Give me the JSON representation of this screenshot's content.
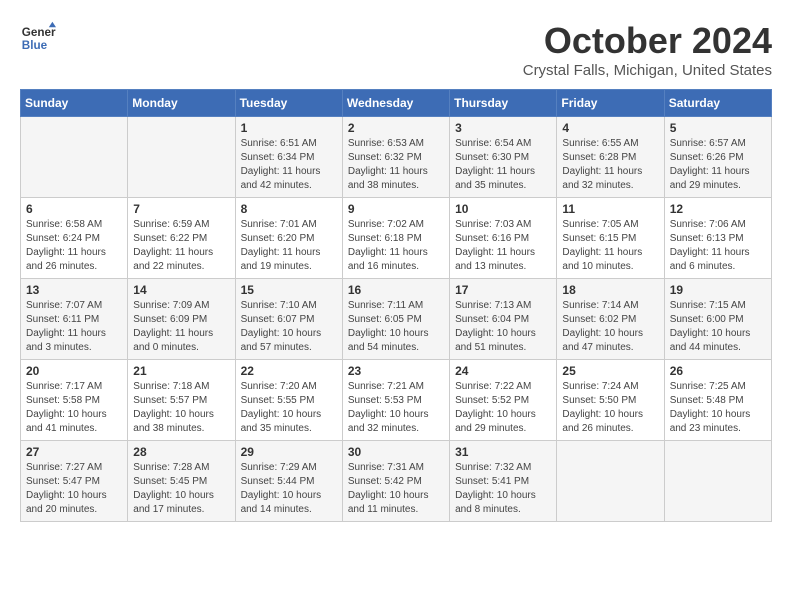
{
  "logo": {
    "line1": "General",
    "line2": "Blue"
  },
  "title": "October 2024",
  "location": "Crystal Falls, Michigan, United States",
  "days_of_week": [
    "Sunday",
    "Monday",
    "Tuesday",
    "Wednesday",
    "Thursday",
    "Friday",
    "Saturday"
  ],
  "weeks": [
    [
      {
        "day": "",
        "info": ""
      },
      {
        "day": "",
        "info": ""
      },
      {
        "day": "1",
        "sunrise": "Sunrise: 6:51 AM",
        "sunset": "Sunset: 6:34 PM",
        "daylight": "Daylight: 11 hours and 42 minutes."
      },
      {
        "day": "2",
        "sunrise": "Sunrise: 6:53 AM",
        "sunset": "Sunset: 6:32 PM",
        "daylight": "Daylight: 11 hours and 38 minutes."
      },
      {
        "day": "3",
        "sunrise": "Sunrise: 6:54 AM",
        "sunset": "Sunset: 6:30 PM",
        "daylight": "Daylight: 11 hours and 35 minutes."
      },
      {
        "day": "4",
        "sunrise": "Sunrise: 6:55 AM",
        "sunset": "Sunset: 6:28 PM",
        "daylight": "Daylight: 11 hours and 32 minutes."
      },
      {
        "day": "5",
        "sunrise": "Sunrise: 6:57 AM",
        "sunset": "Sunset: 6:26 PM",
        "daylight": "Daylight: 11 hours and 29 minutes."
      }
    ],
    [
      {
        "day": "6",
        "sunrise": "Sunrise: 6:58 AM",
        "sunset": "Sunset: 6:24 PM",
        "daylight": "Daylight: 11 hours and 26 minutes."
      },
      {
        "day": "7",
        "sunrise": "Sunrise: 6:59 AM",
        "sunset": "Sunset: 6:22 PM",
        "daylight": "Daylight: 11 hours and 22 minutes."
      },
      {
        "day": "8",
        "sunrise": "Sunrise: 7:01 AM",
        "sunset": "Sunset: 6:20 PM",
        "daylight": "Daylight: 11 hours and 19 minutes."
      },
      {
        "day": "9",
        "sunrise": "Sunrise: 7:02 AM",
        "sunset": "Sunset: 6:18 PM",
        "daylight": "Daylight: 11 hours and 16 minutes."
      },
      {
        "day": "10",
        "sunrise": "Sunrise: 7:03 AM",
        "sunset": "Sunset: 6:16 PM",
        "daylight": "Daylight: 11 hours and 13 minutes."
      },
      {
        "day": "11",
        "sunrise": "Sunrise: 7:05 AM",
        "sunset": "Sunset: 6:15 PM",
        "daylight": "Daylight: 11 hours and 10 minutes."
      },
      {
        "day": "12",
        "sunrise": "Sunrise: 7:06 AM",
        "sunset": "Sunset: 6:13 PM",
        "daylight": "Daylight: 11 hours and 6 minutes."
      }
    ],
    [
      {
        "day": "13",
        "sunrise": "Sunrise: 7:07 AM",
        "sunset": "Sunset: 6:11 PM",
        "daylight": "Daylight: 11 hours and 3 minutes."
      },
      {
        "day": "14",
        "sunrise": "Sunrise: 7:09 AM",
        "sunset": "Sunset: 6:09 PM",
        "daylight": "Daylight: 11 hours and 0 minutes."
      },
      {
        "day": "15",
        "sunrise": "Sunrise: 7:10 AM",
        "sunset": "Sunset: 6:07 PM",
        "daylight": "Daylight: 10 hours and 57 minutes."
      },
      {
        "day": "16",
        "sunrise": "Sunrise: 7:11 AM",
        "sunset": "Sunset: 6:05 PM",
        "daylight": "Daylight: 10 hours and 54 minutes."
      },
      {
        "day": "17",
        "sunrise": "Sunrise: 7:13 AM",
        "sunset": "Sunset: 6:04 PM",
        "daylight": "Daylight: 10 hours and 51 minutes."
      },
      {
        "day": "18",
        "sunrise": "Sunrise: 7:14 AM",
        "sunset": "Sunset: 6:02 PM",
        "daylight": "Daylight: 10 hours and 47 minutes."
      },
      {
        "day": "19",
        "sunrise": "Sunrise: 7:15 AM",
        "sunset": "Sunset: 6:00 PM",
        "daylight": "Daylight: 10 hours and 44 minutes."
      }
    ],
    [
      {
        "day": "20",
        "sunrise": "Sunrise: 7:17 AM",
        "sunset": "Sunset: 5:58 PM",
        "daylight": "Daylight: 10 hours and 41 minutes."
      },
      {
        "day": "21",
        "sunrise": "Sunrise: 7:18 AM",
        "sunset": "Sunset: 5:57 PM",
        "daylight": "Daylight: 10 hours and 38 minutes."
      },
      {
        "day": "22",
        "sunrise": "Sunrise: 7:20 AM",
        "sunset": "Sunset: 5:55 PM",
        "daylight": "Daylight: 10 hours and 35 minutes."
      },
      {
        "day": "23",
        "sunrise": "Sunrise: 7:21 AM",
        "sunset": "Sunset: 5:53 PM",
        "daylight": "Daylight: 10 hours and 32 minutes."
      },
      {
        "day": "24",
        "sunrise": "Sunrise: 7:22 AM",
        "sunset": "Sunset: 5:52 PM",
        "daylight": "Daylight: 10 hours and 29 minutes."
      },
      {
        "day": "25",
        "sunrise": "Sunrise: 7:24 AM",
        "sunset": "Sunset: 5:50 PM",
        "daylight": "Daylight: 10 hours and 26 minutes."
      },
      {
        "day": "26",
        "sunrise": "Sunrise: 7:25 AM",
        "sunset": "Sunset: 5:48 PM",
        "daylight": "Daylight: 10 hours and 23 minutes."
      }
    ],
    [
      {
        "day": "27",
        "sunrise": "Sunrise: 7:27 AM",
        "sunset": "Sunset: 5:47 PM",
        "daylight": "Daylight: 10 hours and 20 minutes."
      },
      {
        "day": "28",
        "sunrise": "Sunrise: 7:28 AM",
        "sunset": "Sunset: 5:45 PM",
        "daylight": "Daylight: 10 hours and 17 minutes."
      },
      {
        "day": "29",
        "sunrise": "Sunrise: 7:29 AM",
        "sunset": "Sunset: 5:44 PM",
        "daylight": "Daylight: 10 hours and 14 minutes."
      },
      {
        "day": "30",
        "sunrise": "Sunrise: 7:31 AM",
        "sunset": "Sunset: 5:42 PM",
        "daylight": "Daylight: 10 hours and 11 minutes."
      },
      {
        "day": "31",
        "sunrise": "Sunrise: 7:32 AM",
        "sunset": "Sunset: 5:41 PM",
        "daylight": "Daylight: 10 hours and 8 minutes."
      },
      {
        "day": "",
        "info": ""
      },
      {
        "day": "",
        "info": ""
      }
    ]
  ]
}
